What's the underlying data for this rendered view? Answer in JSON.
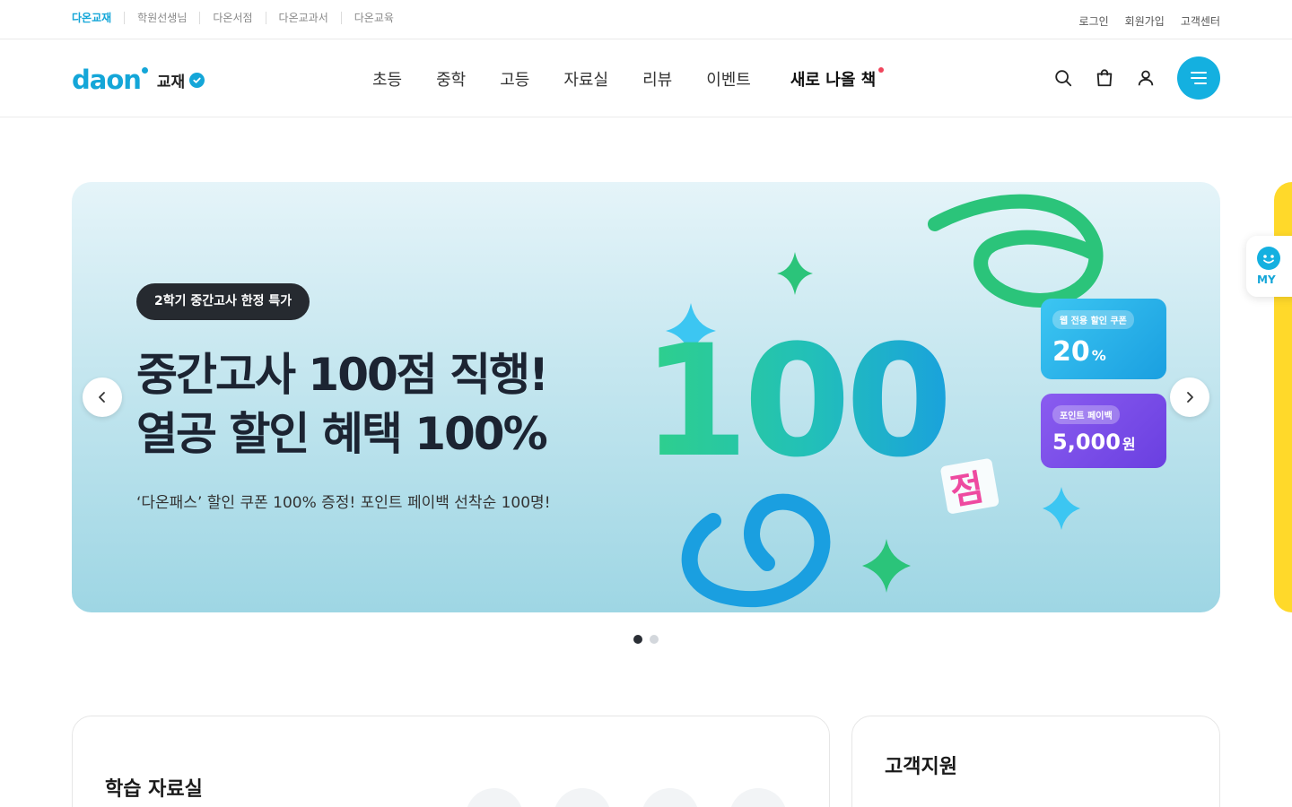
{
  "topbar": {
    "sites": [
      "다온교재",
      "학원선생님",
      "다온서점",
      "다온교과서",
      "다온교육"
    ],
    "util": [
      "로그인",
      "회원가입",
      "고객센터"
    ]
  },
  "header": {
    "logo_text": "daon",
    "logo_sub": "교재",
    "nav": [
      "초등",
      "중학",
      "고등",
      "자료실",
      "리뷰",
      "이벤트",
      "새로 나올 책"
    ]
  },
  "hero": {
    "badge": "2학기 중간고사 한정 특가",
    "headline_1": "중간고사 100점 직행!",
    "headline_2": "열공 할인 혜택 100%",
    "desc": "‘다온패스’ 할인 쿠폰 100% 증정! 포인트 페이백 선착순 100명!",
    "big_number": "100",
    "score_char": "점",
    "coupon1": {
      "tag": "웹 전용 할인 쿠폰",
      "value": "20",
      "unit": "%"
    },
    "coupon2": {
      "tag": "포인트 페이백",
      "value": "5,000",
      "unit": "원"
    },
    "slides_total": 2,
    "slide_current": 1
  },
  "side": {
    "my_label": "MY"
  },
  "cards": {
    "study": "학습 자료실",
    "support": "고객지원"
  },
  "colors": {
    "brand": "#14a6d8",
    "dark": "#262a30",
    "green": "#2bc47a",
    "purple": "#7a4ee8",
    "pink": "#ee4aa0"
  }
}
